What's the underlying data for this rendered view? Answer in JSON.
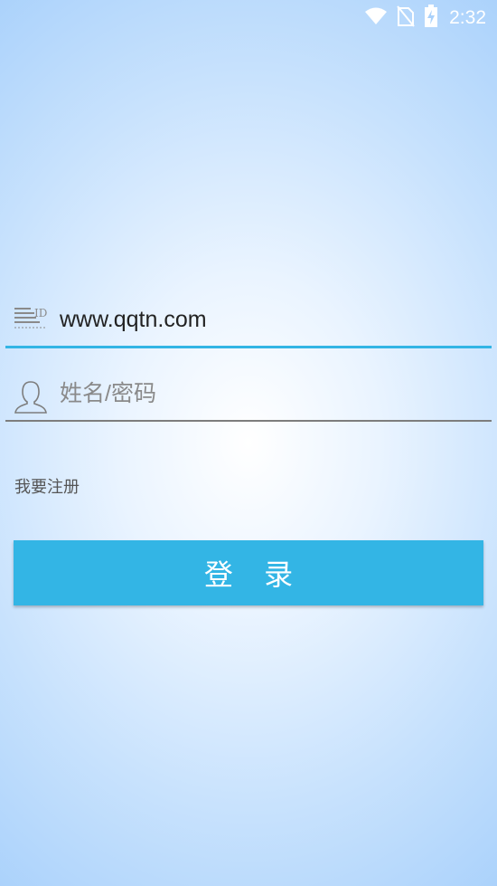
{
  "status_bar": {
    "time": "2:32",
    "icons": [
      "wifi-icon",
      "no-sim-icon",
      "battery-charging-icon"
    ]
  },
  "login_form": {
    "account_field": {
      "value": "www.qqtn.com",
      "icon": "id-card-icon"
    },
    "password_field": {
      "placeholder": "姓名/密码",
      "icon": "user-icon"
    },
    "register_link": "我要注册",
    "login_button": "登 录"
  },
  "colors": {
    "accent": "#33b5e5",
    "background_center": "#ffffff",
    "background_edge": "#a9d1fb"
  }
}
